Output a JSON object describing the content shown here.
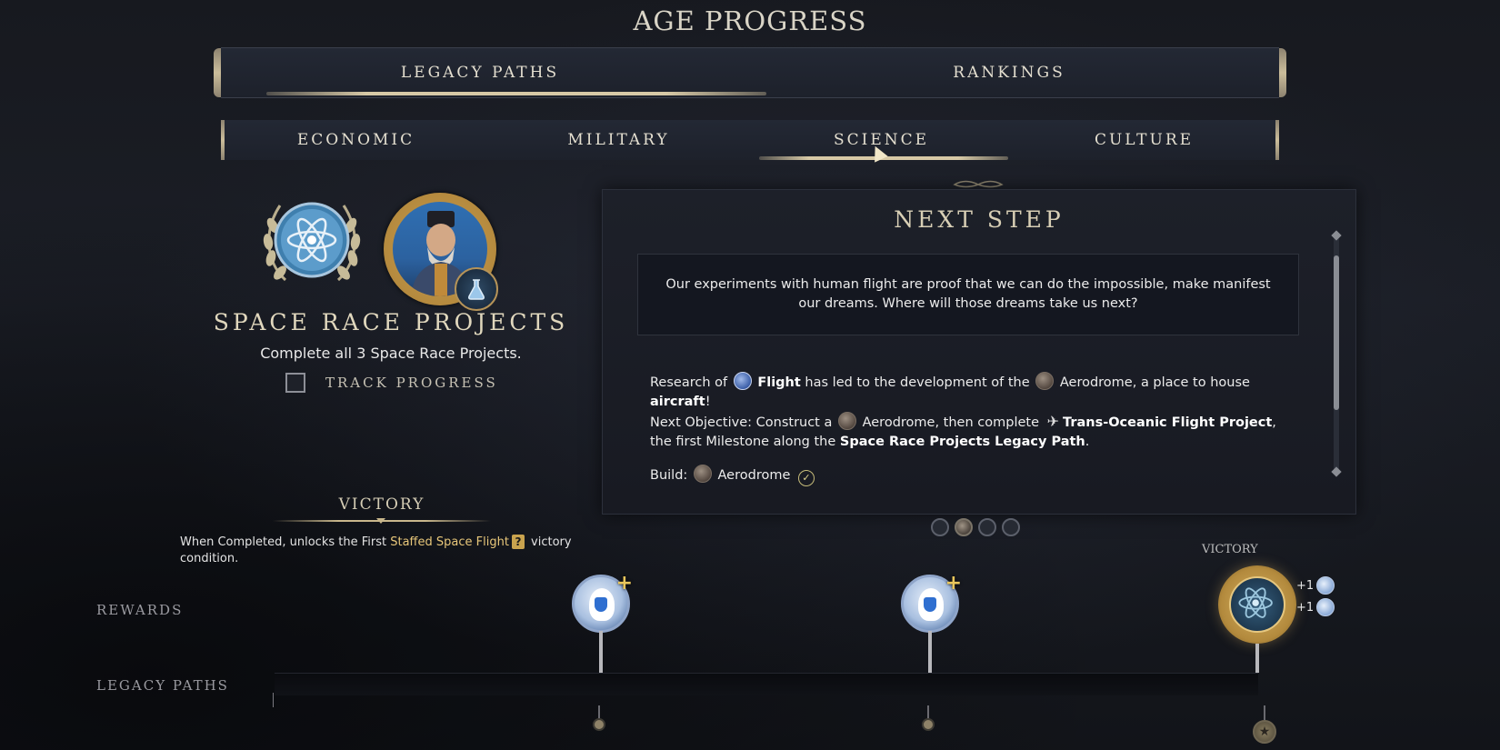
{
  "page": {
    "title": "AGE PROGRESS"
  },
  "main_tabs": [
    {
      "label": "LEGACY PATHS",
      "selected": true
    },
    {
      "label": "RANKINGS",
      "selected": false
    }
  ],
  "sub_tabs": [
    {
      "label": "ECONOMIC",
      "selected": false
    },
    {
      "label": "MILITARY",
      "selected": false
    },
    {
      "label": "SCIENCE",
      "selected": true
    },
    {
      "label": "CULTURE",
      "selected": false
    }
  ],
  "legacy_path": {
    "title": "SPACE RACE PROJECTS",
    "description": "Complete all 3 Space Race Projects.",
    "track_label": "TRACK PROGRESS",
    "track_checked": false
  },
  "victory": {
    "heading": "VICTORY",
    "desc_prefix": "When Completed, unlocks the First ",
    "desc_highlight": "Staffed Space Flight",
    "desc_qmark": "?",
    "desc_suffix": " victory condition."
  },
  "next_step": {
    "title": "NEXT STEP",
    "quote": "Our experiments with human flight are proof that we can do the impossible, make manifest our dreams. Where will those dreams take us next?",
    "p1": {
      "a": "Research of ",
      "flight": "Flight",
      "b": " has led to the development of the ",
      "c": "Aerodrome, a place to house ",
      "aircraft": "aircraft",
      "d": "!"
    },
    "p2": {
      "a": "Next Objective: Construct a ",
      "b": "Aerodrome, then complete ",
      "project": "Trans-Oceanic Flight Project",
      "c": ", the first Milestone along the ",
      "path": "Space Race Projects Legacy Path",
      "d": "."
    },
    "build": {
      "label": "Build:",
      "item": "Aerodrome",
      "done": true
    },
    "pager": {
      "count": 4,
      "active_index": 1
    }
  },
  "rewards_row": {
    "label": "REWARDS",
    "victory_label": "VICTORY",
    "bonuses": [
      "+1",
      "+1"
    ]
  },
  "legacy_paths_row": {
    "label": "LEGACY PATHS"
  },
  "icons": {
    "flight": "flight-icon",
    "aerodrome": "aerodrome-icon",
    "plane": "plane-icon",
    "science": "atom-icon",
    "check": "check-icon"
  },
  "colors": {
    "accent_gold": "#d7c9a6",
    "highlight_gold": "#e8c77a",
    "background": "#17191f"
  }
}
